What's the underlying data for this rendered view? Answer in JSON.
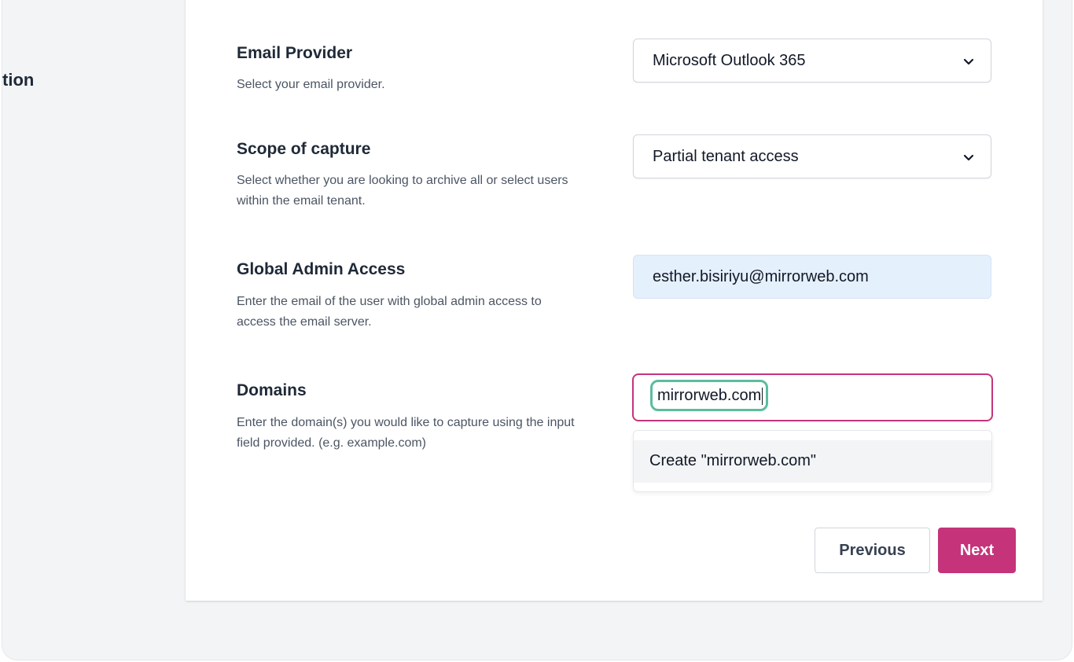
{
  "section": {
    "heading": "tion"
  },
  "fields": {
    "email_provider": {
      "title": "Email Provider",
      "description": "Select your email provider.",
      "selected": "Microsoft Outlook 365"
    },
    "scope": {
      "title": "Scope of capture",
      "description": "Select whether you are looking to archive all or select users within the email tenant.",
      "selected": "Partial tenant access"
    },
    "global_admin": {
      "title": "Global Admin Access",
      "description": "Enter the email of the user with global admin access to access the email server.",
      "value": "esther.bisiriyu@mirrorweb.com"
    },
    "domains": {
      "title": "Domains",
      "description": "Enter the domain(s) you would like to capture using the input field provided. (e.g. example.com)",
      "typed_value": "mirrorweb.com",
      "create_option": "Create \"mirrorweb.com\""
    }
  },
  "buttons": {
    "previous": "Previous",
    "next": "Next"
  },
  "colors": {
    "accent": "#c5347a",
    "focus_ring": "#5bbd9e",
    "autofill_bg": "#e5f0fd"
  },
  "icons": {
    "select_chevron": "chevron-down-icon"
  }
}
